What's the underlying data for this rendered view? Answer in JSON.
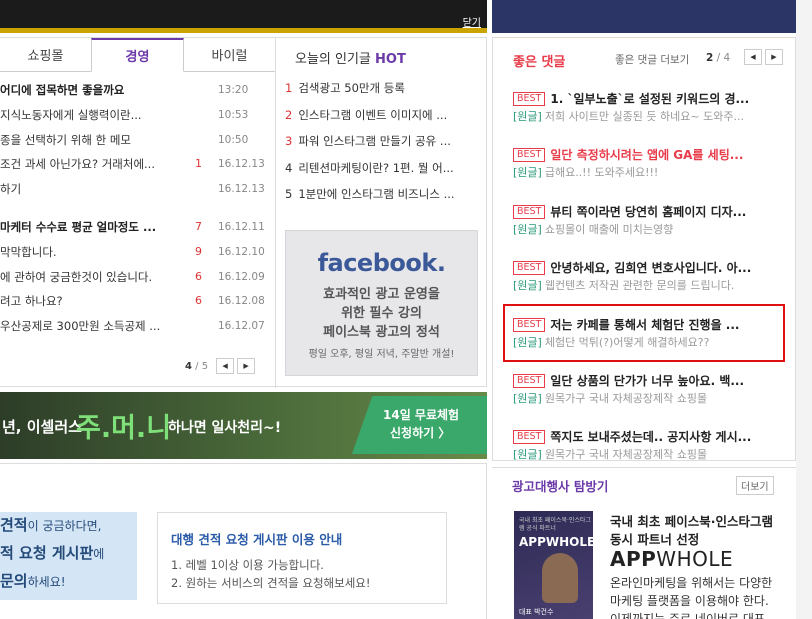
{
  "top_banner": {
    "close_label": "닫기"
  },
  "left_tabs": [
    {
      "label": "쇼핑몰"
    },
    {
      "label": "경영"
    },
    {
      "label": "바이럴"
    }
  ],
  "left_list": [
    {
      "title": "어디에 접목하면 좋을까요",
      "count": "",
      "date": "13:20",
      "bold": true
    },
    {
      "title": "지식노동자에게 실행력이란...",
      "count": "",
      "date": "10:53"
    },
    {
      "title": "종을 선택하기 위해 한 메모",
      "count": "",
      "date": "10:50"
    },
    {
      "title": "조건 과세 아닌가요? 거래처에...",
      "count": "1",
      "date": "16.12.13"
    },
    {
      "title": "하기",
      "count": "",
      "date": "16.12.13"
    },
    {
      "title": "마케터 수수료 평균 얼마정도 ...",
      "count": "7",
      "date": "16.12.11",
      "bold": true
    },
    {
      "title": "막막합니다.",
      "count": "9",
      "date": "16.12.10"
    },
    {
      "title": "에 관하여 궁금한것이 있습니다.",
      "count": "6",
      "date": "16.12.09"
    },
    {
      "title": "려고 하나요?",
      "count": "6",
      "date": "16.12.08"
    },
    {
      "title": "우산공제로 300만원 소득공제 ...",
      "count": "",
      "date": "16.12.07"
    }
  ],
  "left_pager": {
    "current": "4",
    "total": "/ 5"
  },
  "hot": {
    "title": "오늘의 인기글",
    "badge": "HOT",
    "items": [
      {
        "num": "1",
        "title": "검색광고 50만개 등록"
      },
      {
        "num": "2",
        "title": "인스타그램 이벤트 이미지에 ..."
      },
      {
        "num": "3",
        "title": "파워 인스타그램 만들기 공유 ..."
      },
      {
        "num": "4",
        "title": "리텐션마케팅이란? 1편. 뭘 어..."
      },
      {
        "num": "5",
        "title": "1분만에 인스타그램 비즈니스 ..."
      }
    ]
  },
  "fb_ad": {
    "logo": "facebook.",
    "line1": "효과적인 광고 운영을",
    "line2": "위한 필수 강의",
    "line3": "페이스북 광고의 정석",
    "sub": "평일 오후, 평일 저녁, 주말반 개설!"
  },
  "mid_banner": {
    "part1": "년, 이셀러스",
    "brand": "주.머.니",
    "part2": "하나면 일사천리~!",
    "cta1": "14일 무료체험",
    "cta2": "신청하기 〉"
  },
  "quote_box": {
    "l1a": "견적",
    "l1b": "이 궁금하다면,",
    "l2a": "적 요청 게시판",
    "l2b": "에",
    "l3a": "문의",
    "l3b": "하세요!"
  },
  "guide": {
    "title": "대행 견적 요청 게시판 이용 안내",
    "item1": "1. 레벨 1이상 이용 가능합니다.",
    "item2": "2. 원하는 서비스의 견적을 요청해보세요!"
  },
  "best_replies": {
    "title": "좋은 댓글",
    "more": "좋은 댓글 더보기",
    "current": "2",
    "total": "/ 4",
    "badge": "BEST",
    "tag": "[원글]",
    "items": [
      {
        "title": "1. `일부노출`로 설정된 키워드의 경...",
        "orig": "저희 사이트만 실종된 듯 하네요~ 도와주...",
        "red": false
      },
      {
        "title": "일단 측정하시려는 앱에 GA를 세팅...",
        "orig": "급해요..!! 도와주세요!!!",
        "red": true
      },
      {
        "title": "뷰티 쪽이라면 당연히 홈페이지 디자...",
        "orig": "쇼핑몰이 매출에 미치는영향",
        "red": false
      },
      {
        "title": "안녕하세요, 김희연 변호사입니다. 아...",
        "orig": "웹컨텐츠 저작권 관련한 문의를 드립니다.",
        "red": false
      },
      {
        "title": "저는 카페를 통해서 체험단 진행을 ...",
        "orig": "체험단 먹튀(?)어떻게 해결하세요??",
        "red": false
      },
      {
        "title": "일단 상품의 단가가 너무 높아요. 백...",
        "orig": "원목가구 국내 자체공장제작 쇼핑몰",
        "red": false
      },
      {
        "title": "쪽지도 보내주셨는데.. 공지사항 게시...",
        "orig": "원목가구 국내 자체공장제작 쇼핑몰",
        "red": false
      }
    ]
  },
  "agency": {
    "title": "광고대행사 탐방기",
    "more": "더보기",
    "book_title": "국내 최초 페이스북·인스타그램 공식 파트너",
    "book_brand": "APPWHOLE",
    "book_name": "대표 박건수",
    "h1": "국내 최초 페이스북·인스타그램",
    "h2": "동시 파트너 선정",
    "brand_a": "APP",
    "brand_b": "WHOLE",
    "d1": "온라인마케팅을 위해서는 다양한",
    "d2": "마케팅 플랫폼을 이용해야 한다.",
    "d3": "이제까지는 주로 네이버로 대표 ..."
  }
}
